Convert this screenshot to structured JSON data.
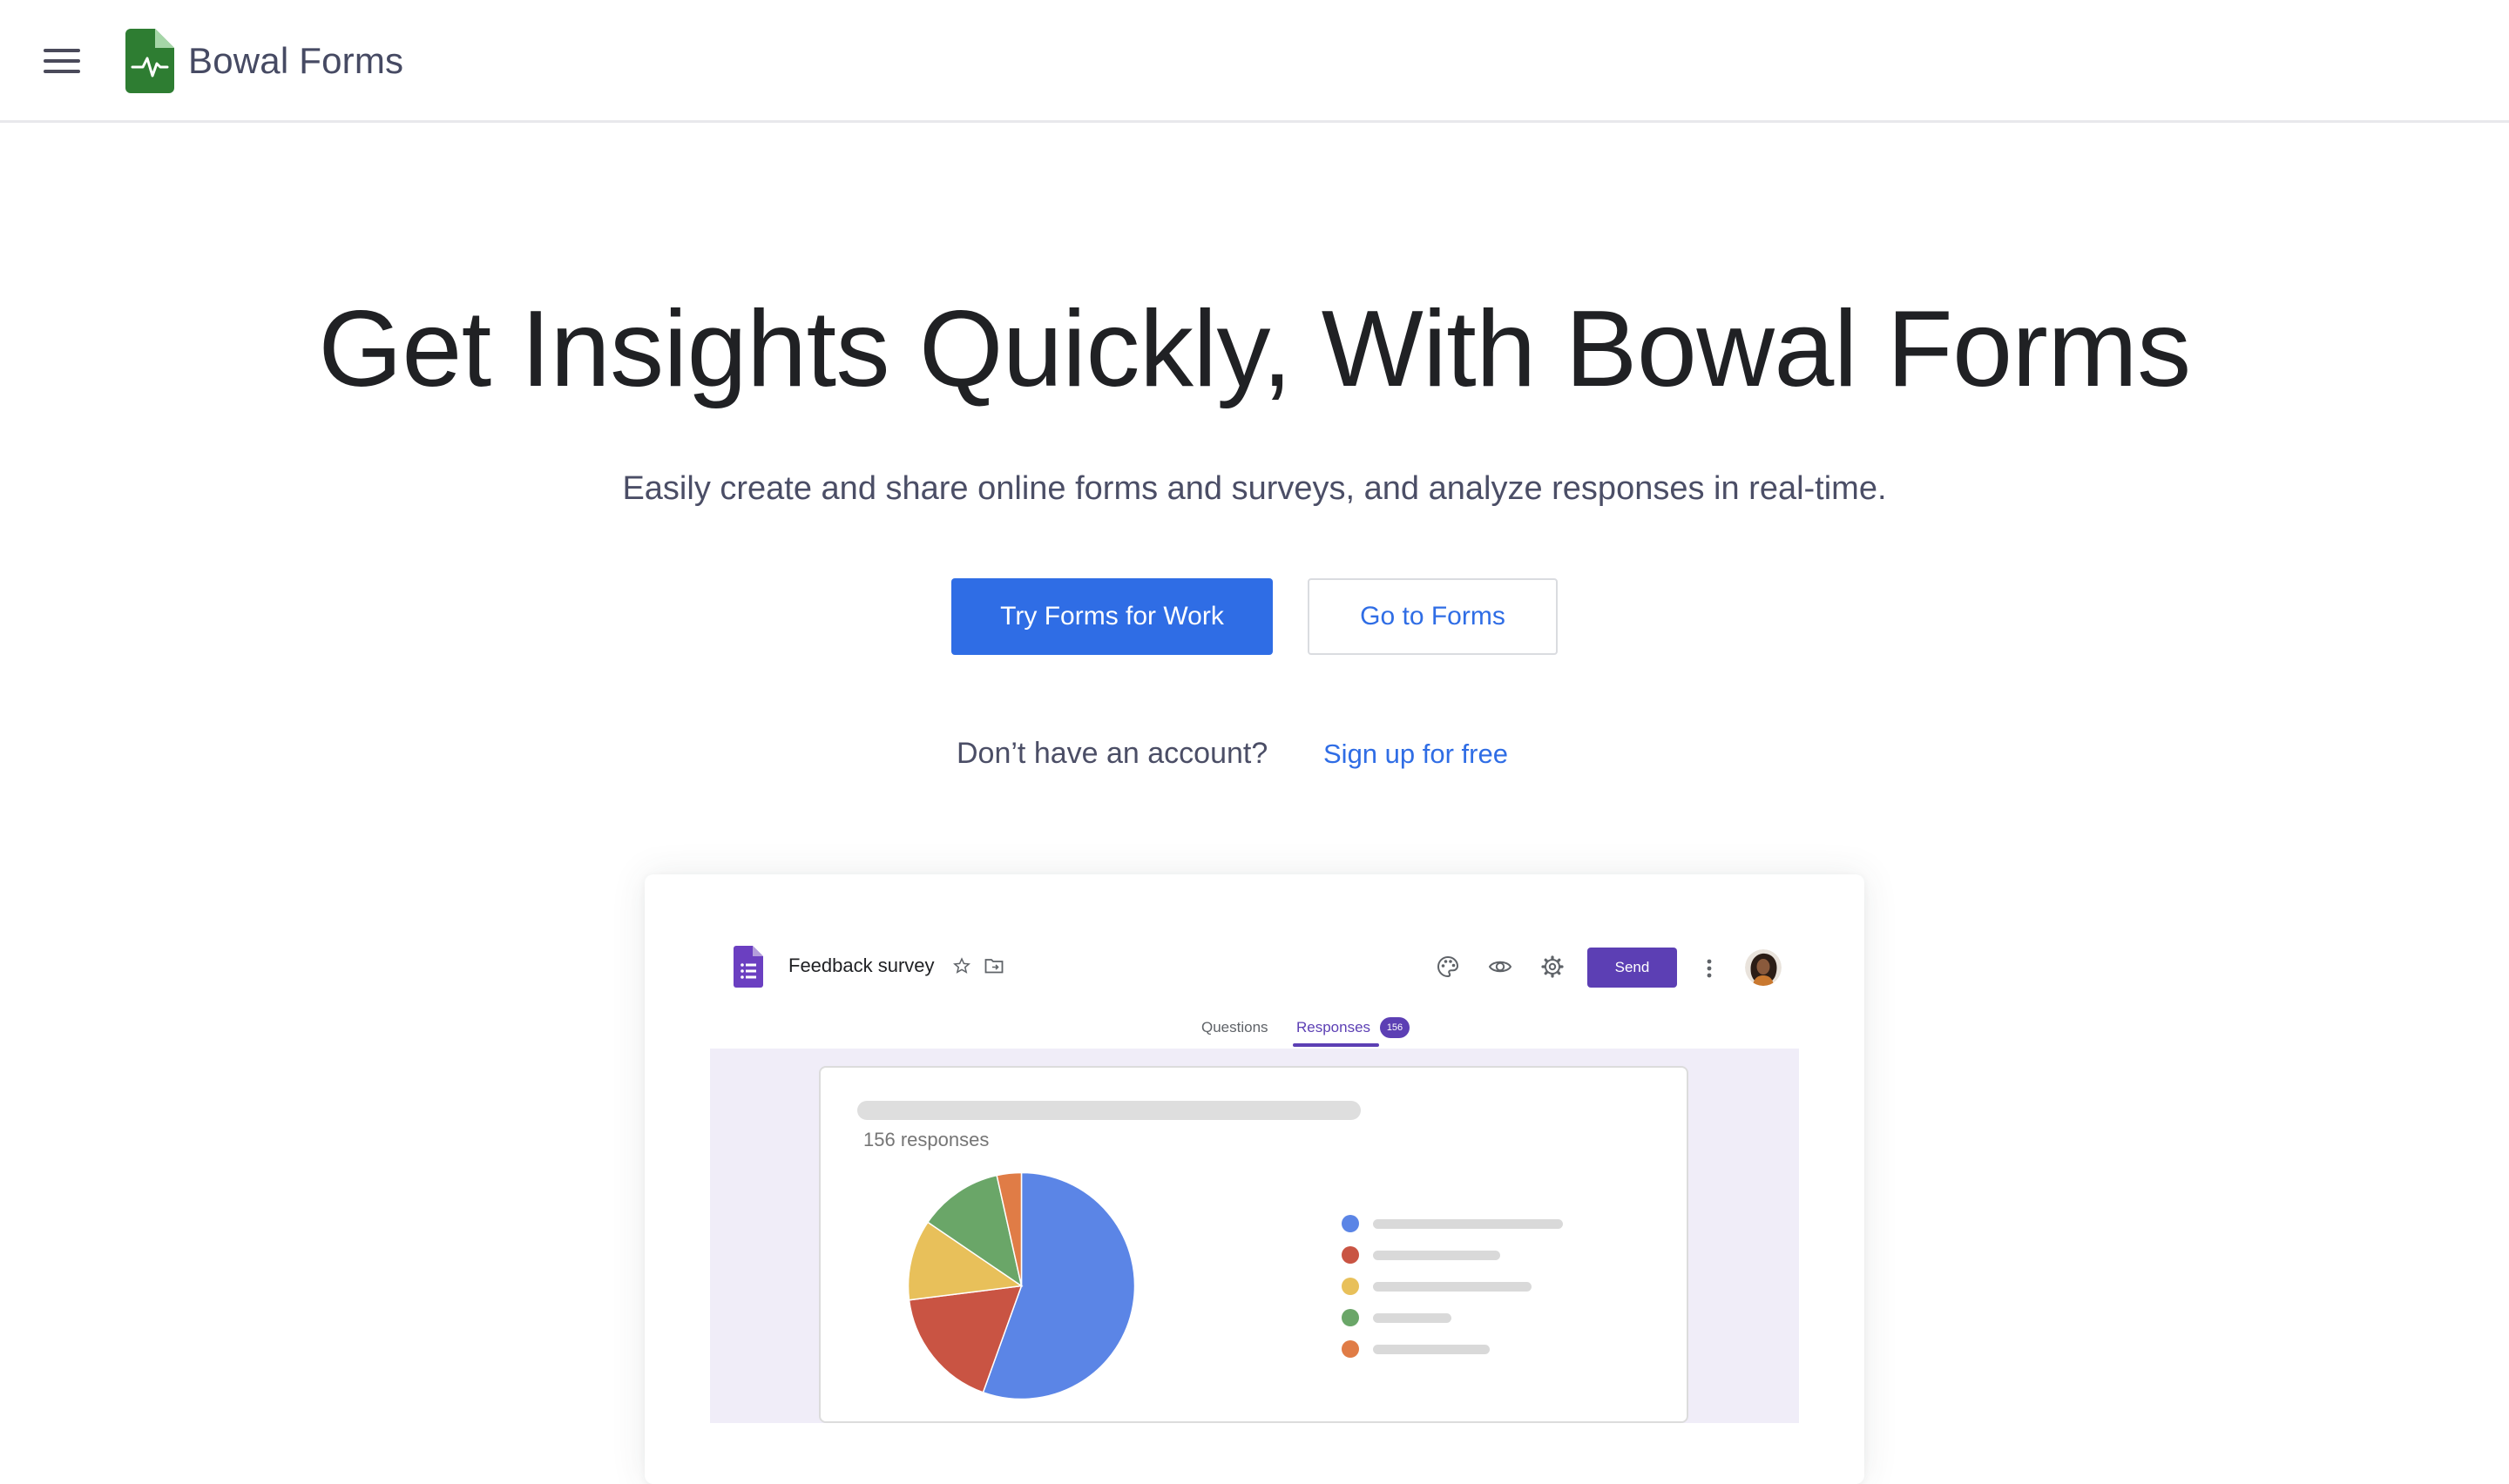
{
  "header": {
    "brand": "Bowal Forms",
    "brand_color": "#2e7d32"
  },
  "hero": {
    "title": "Get Insights Quickly, With Bowal Forms",
    "subtitle": "Easily create and share online forms and surveys, and analyze responses in real-time.",
    "primary_cta": "Try Forms for Work",
    "secondary_cta": "Go to Forms",
    "no_account_text": "Don’t have an account?",
    "signup_link": "Sign up for free",
    "accent_color": "#2f6de5"
  },
  "preview": {
    "form_title": "Feedback survey",
    "send_label": "Send",
    "tabs": [
      {
        "label": "Questions"
      },
      {
        "label": "Responses",
        "badge": "156"
      }
    ],
    "responses_summary": "156 responses",
    "accent_color": "#5c3fb4",
    "toolbar_icons": [
      "palette-icon",
      "eye-icon",
      "gear-icon",
      "more-vert-icon"
    ],
    "legend_colors": [
      "#5b85e6",
      "#c95443",
      "#e8c05a",
      "#6aa668",
      "#e07c46"
    ]
  },
  "chart_data": {
    "type": "pie",
    "values": [
      55.5,
      17.5,
      11.5,
      12,
      3.5
    ],
    "colors": [
      "#5b85e6",
      "#c95443",
      "#e8c05a",
      "#6aa668",
      "#e07c46"
    ]
  }
}
